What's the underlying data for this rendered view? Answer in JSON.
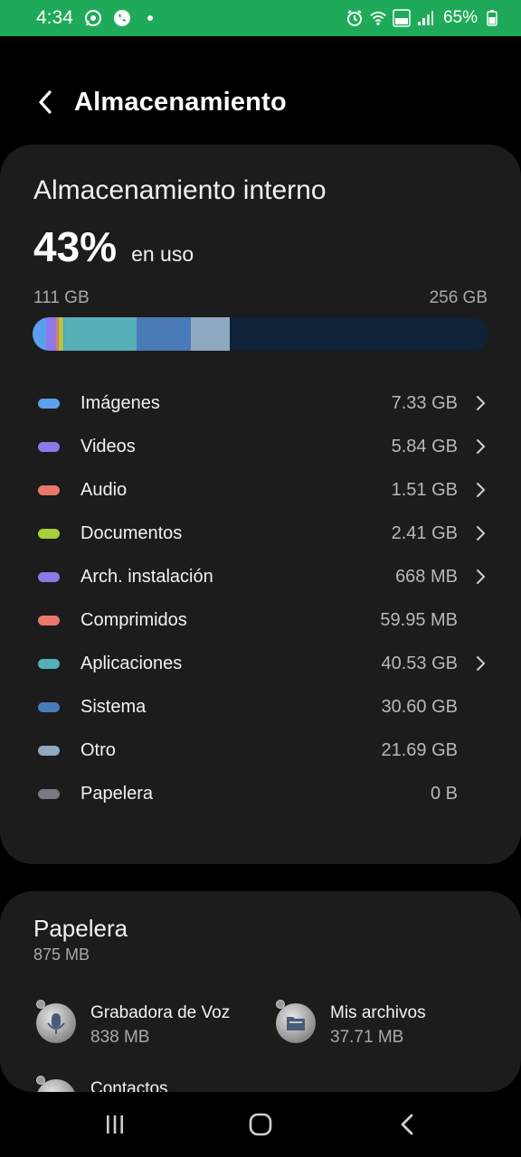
{
  "status_bar": {
    "time": "4:34",
    "battery": "65%"
  },
  "header": {
    "title": "Almacenamiento"
  },
  "storage": {
    "title": "Almacenamiento interno",
    "percent": "43%",
    "percent_label": "en uso",
    "used": "111 GB",
    "total": "256 GB",
    "usage_fraction": 0.43,
    "bar_segments": [
      {
        "name": "Imágenes",
        "color": "#5aa0ee",
        "fraction": 0.029
      },
      {
        "name": "Videos",
        "color": "#8c7ae8",
        "fraction": 0.023
      },
      {
        "name": "Audio",
        "color": "#e8786a",
        "fraction": 0.006
      },
      {
        "name": "Documentos",
        "color": "#a6cf38",
        "fraction": 0.009
      },
      {
        "name": "Arch. instalación",
        "color": "#8c7ae8",
        "fraction": 0.003
      },
      {
        "name": "Aplicaciones",
        "color": "#56b0b8",
        "fraction": 0.158
      },
      {
        "name": "Sistema",
        "color": "#4a7ab8",
        "fraction": 0.12
      },
      {
        "name": "Otro",
        "color": "#8faac0",
        "fraction": 0.085
      }
    ],
    "categories": [
      {
        "name": "Imágenes",
        "size": "7.33 GB",
        "color": "#5aa0ee",
        "chevron": true
      },
      {
        "name": "Videos",
        "size": "5.84 GB",
        "color": "#8c7ae8",
        "chevron": true
      },
      {
        "name": "Audio",
        "size": "1.51 GB",
        "color": "#e8786a",
        "chevron": true
      },
      {
        "name": "Documentos",
        "size": "2.41 GB",
        "color": "#a6cf38",
        "chevron": true
      },
      {
        "name": "Arch. instalación",
        "size": "668 MB",
        "color": "#8c7ae8",
        "chevron": true
      },
      {
        "name": "Comprimidos",
        "size": "59.95 MB",
        "color": "#e8786a",
        "chevron": false
      },
      {
        "name": "Aplicaciones",
        "size": "40.53 GB",
        "color": "#56b0b8",
        "chevron": true
      },
      {
        "name": "Sistema",
        "size": "30.60 GB",
        "color": "#4a7ab8",
        "chevron": false
      },
      {
        "name": "Otro",
        "size": "21.69 GB",
        "color": "#8faac0",
        "chevron": false
      },
      {
        "name": "Papelera",
        "size": "0 B",
        "color": "#7a7a82",
        "chevron": false
      }
    ]
  },
  "trash": {
    "title": "Papelera",
    "size": "875 MB",
    "items": [
      {
        "name": "Grabadora de Voz",
        "size": "838 MB",
        "icon": "voice-recorder-icon"
      },
      {
        "name": "Mis archivos",
        "size": "37.71 MB",
        "icon": "my-files-icon"
      },
      {
        "name": "Contactos",
        "size": "",
        "icon": "contacts-icon"
      }
    ]
  },
  "nav_bar": {
    "icons": [
      "recents-icon",
      "home-icon",
      "back-icon"
    ]
  }
}
